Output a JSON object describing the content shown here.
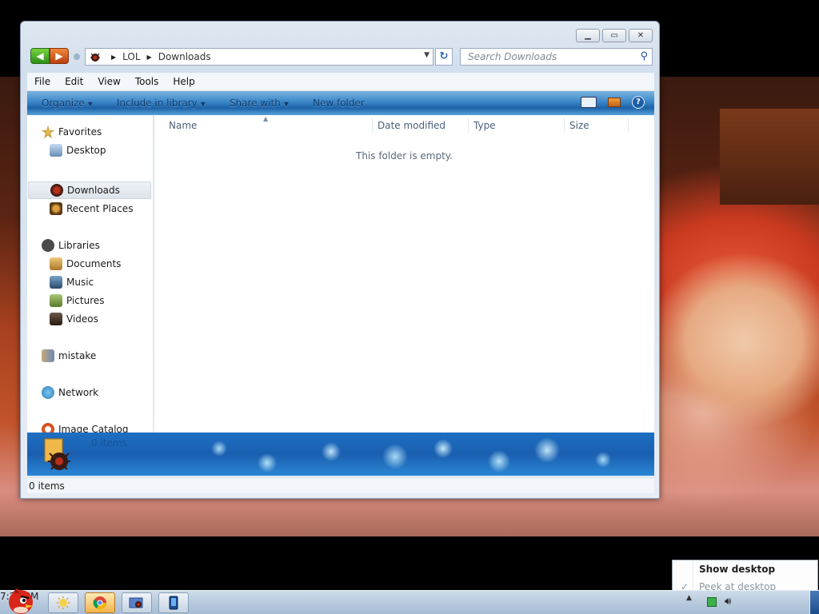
{
  "window": {
    "address": {
      "root": "LOL",
      "current": "Downloads"
    },
    "search": {
      "placeholder": "Search Downloads"
    },
    "menubar": [
      "File",
      "Edit",
      "View",
      "Tools",
      "Help"
    ],
    "toolbar": {
      "organize": "Organize",
      "include_in_library": "Include in library",
      "share_with": "Share with",
      "new_folder": "New folder"
    },
    "nav": {
      "favorites": "Favorites",
      "desktop": "Desktop",
      "downloads": "Downloads",
      "recent_places": "Recent Places",
      "libraries": "Libraries",
      "documents": "Documents",
      "music": "Music",
      "pictures": "Pictures",
      "videos": "Videos",
      "mistake": "mistake",
      "network": "Network",
      "image_catalog": "Image Catalog"
    },
    "columns": {
      "name": "Name",
      "date_modified": "Date modified",
      "type": "Type",
      "size": "Size"
    },
    "empty_message": "This folder is empty.",
    "details": {
      "item_count": "0 items"
    },
    "status": {
      "item_count": "0 items"
    }
  },
  "taskbar": {
    "clock": "7:20 PM"
  },
  "peek_menu": {
    "show_desktop": "Show desktop",
    "peek_at_desktop": "Peek at desktop"
  },
  "colors": {
    "command_bar": "#1c62a8",
    "back_arrow": "#2d8f18",
    "forward_arrow": "#b8400e"
  }
}
